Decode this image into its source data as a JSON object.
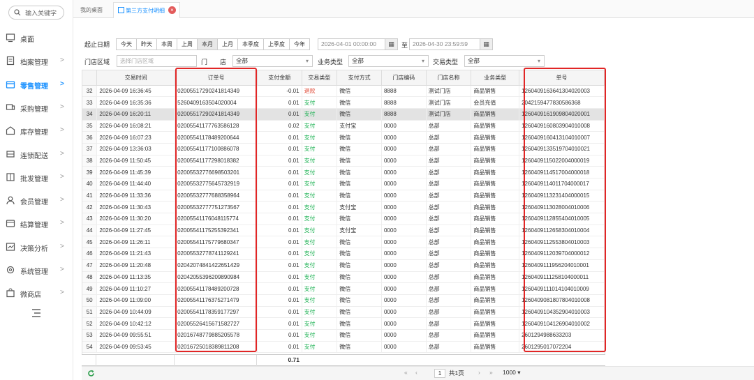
{
  "sidebar": {
    "search_placeholder": "输入关键字",
    "items": [
      {
        "label": "桌面",
        "icon": "monitor-icon",
        "active": false,
        "arrow": ""
      },
      {
        "label": "档案管理",
        "icon": "file-icon",
        "active": false,
        "arrow": ">"
      },
      {
        "label": "零售管理",
        "icon": "store-icon",
        "active": true,
        "arrow": ">"
      },
      {
        "label": "采购管理",
        "icon": "truck-icon",
        "active": false,
        "arrow": ">"
      },
      {
        "label": "库存管理",
        "icon": "warehouse-icon",
        "active": false,
        "arrow": ">"
      },
      {
        "label": "连锁配送",
        "icon": "delivery-icon",
        "active": false,
        "arrow": ">"
      },
      {
        "label": "批发管理",
        "icon": "wholesale-icon",
        "active": false,
        "arrow": ">"
      },
      {
        "label": "会员管理",
        "icon": "user-icon",
        "active": false,
        "arrow": ">"
      },
      {
        "label": "结算管理",
        "icon": "wallet-icon",
        "active": false,
        "arrow": ">"
      },
      {
        "label": "决策分析",
        "icon": "chart-icon",
        "active": false,
        "arrow": ">"
      },
      {
        "label": "系统管理",
        "icon": "gear-icon",
        "active": false,
        "arrow": ">"
      },
      {
        "label": "微商店",
        "icon": "shop-icon",
        "active": false,
        "arrow": ">"
      }
    ]
  },
  "tabs": {
    "home": "我的桌面",
    "current": "第三方支付明细",
    "close": "×"
  },
  "filters": {
    "date_label": "起止日期",
    "quick": [
      "今天",
      "昨天",
      "本周",
      "上周",
      "本月",
      "上月",
      "本季度",
      "上季度",
      "今年"
    ],
    "quick_active": "本月",
    "start": "2026-04-01 00:00:00",
    "to": "至",
    "end": "2026-04-30 23:59:59",
    "region_label": "门店区域",
    "region_placeholder": "选择门店区域",
    "store_label": "门　　店",
    "store_value": "全部",
    "biz_label": "业务类型",
    "biz_value": "全部",
    "trade_label": "交易类型",
    "trade_value": "全部"
  },
  "table": {
    "columns": [
      "",
      "交易时间",
      "订单号",
      "支付金额",
      "交易类型",
      "支付方式",
      "门店编码",
      "门店名称",
      "业务类型",
      "单号"
    ],
    "rows": [
      [
        "32",
        "2026-04-09 16:36:45",
        "02005517290241814349",
        "-0.01",
        "退款",
        "微信",
        "8888",
        "测试门店",
        "商品销售",
        "12604091636413040200​03"
      ],
      [
        "33",
        "2026-04-09 16:35:36",
        "5260409163504020004",
        "0.01",
        "支付",
        "微信",
        "8888",
        "测试门店",
        "会员充值",
        "2042159477830586368"
      ],
      [
        "34",
        "2026-04-09 16:20:11",
        "02005517290241814349",
        "0.01",
        "支付",
        "微信",
        "8888",
        "测试门店",
        "商品销售",
        "126040916190980402000​1"
      ],
      [
        "35",
        "2026-04-09 16:08:21",
        "02005541177763586128",
        "0.02",
        "支付",
        "支付宝",
        "0000",
        "总部",
        "商品销售",
        "1260409160803904010008"
      ],
      [
        "36",
        "2026-04-09 16:07:23",
        "02005541178489200644",
        "0.01",
        "支付",
        "微信",
        "0000",
        "总部",
        "商品销售",
        "1260409160413104010007"
      ],
      [
        "37",
        "2026-04-09 13:36:03",
        "02005541177100886078",
        "0.01",
        "支付",
        "微信",
        "0000",
        "总部",
        "商品销售",
        "1260409133519704010021"
      ],
      [
        "38",
        "2026-04-09 11:50:45",
        "02005541177298018382",
        "0.01",
        "支付",
        "微信",
        "0000",
        "总部",
        "商品销售",
        "1260409115022004000019"
      ],
      [
        "39",
        "2026-04-09 11:45:39",
        "02005532776698503201",
        "0.01",
        "支付",
        "微信",
        "0000",
        "总部",
        "商品销售",
        "1260409114517004000018"
      ],
      [
        "40",
        "2026-04-09 11:44:40",
        "02005532775645732919",
        "0.01",
        "支付",
        "微信",
        "0000",
        "总部",
        "商品销售",
        "1260409114011704000017"
      ],
      [
        "41",
        "2026-04-09 11:33:36",
        "02005532777688358964",
        "0.01",
        "支付",
        "微信",
        "0000",
        "总部",
        "商品销售",
        "1260409113231404000015"
      ],
      [
        "42",
        "2026-04-09 11:30:43",
        "02005532777751273567",
        "0.01",
        "支付",
        "支付宝",
        "0000",
        "总部",
        "商品销售",
        "1260409113028004010006"
      ],
      [
        "43",
        "2026-04-09 11:30:20",
        "02005541176048115774",
        "0.01",
        "支付",
        "微信",
        "0000",
        "总部",
        "商品销售",
        "1260409112855404010005"
      ],
      [
        "44",
        "2026-04-09 11:27:45",
        "02005541175255392341",
        "0.01",
        "支付",
        "支付宝",
        "0000",
        "总部",
        "商品销售",
        "1260409112658304010004"
      ],
      [
        "45",
        "2026-04-09 11:26:11",
        "02005541175779680347",
        "0.01",
        "支付",
        "微信",
        "0000",
        "总部",
        "商品销售",
        "1260409112553804010003"
      ],
      [
        "46",
        "2026-04-09 11:21:43",
        "02005532778741129241",
        "0.01",
        "支付",
        "微信",
        "0000",
        "总部",
        "商品销售",
        "1260409112039704000012"
      ],
      [
        "47",
        "2026-04-09 11:20:48",
        "02042074841422651429",
        "0.01",
        "支付",
        "微信",
        "0000",
        "总部",
        "商品销售",
        "1260409111956204010001"
      ],
      [
        "48",
        "2026-04-09 11:13:35",
        "02042055396209890984",
        "0.01",
        "支付",
        "微信",
        "0000",
        "总部",
        "商品销售",
        "1260409111258104000011"
      ],
      [
        "49",
        "2026-04-09 11:10:27",
        "02005541178489200728",
        "0.01",
        "支付",
        "微信",
        "0000",
        "总部",
        "商品销售",
        "1260409111014104010009"
      ],
      [
        "50",
        "2026-04-09 11:09:00",
        "02005541176375271479",
        "0.01",
        "支付",
        "微信",
        "0000",
        "总部",
        "商品销售",
        "1260409081807804010008"
      ],
      [
        "51",
        "2026-04-09 10:44:09",
        "02005541178359177297",
        "0.01",
        "支付",
        "微信",
        "0000",
        "总部",
        "商品销售",
        "1260409104352904010003"
      ],
      [
        "52",
        "2026-04-09 10:42:12",
        "02005526415671582727",
        "0.01",
        "支付",
        "微信",
        "0000",
        "总部",
        "商品销售",
        "1260409104126904010002"
      ],
      [
        "53",
        "2026-04-09 09:55:51",
        "02016748779885205578",
        "0.01",
        "支付",
        "微信",
        "0000",
        "总部",
        "商品销售",
        "2601294988633203"
      ],
      [
        "54",
        "2026-04-09 09:53:45",
        "02016725018389811208",
        "0.01",
        "支付",
        "微信",
        "0000",
        "总部",
        "商品销售",
        "2601295017072204"
      ]
    ],
    "highlight_row": "34",
    "total": "0.71"
  },
  "pager": {
    "first": "«",
    "prev": "‹",
    "page": "1",
    "total": "共1页",
    "next": "›",
    "last": "»",
    "size": "1000"
  },
  "colors": {
    "accent": "#1890ff",
    "refund": "#e14d3a",
    "pay": "#19b050",
    "highlight_box": "#e12626"
  }
}
